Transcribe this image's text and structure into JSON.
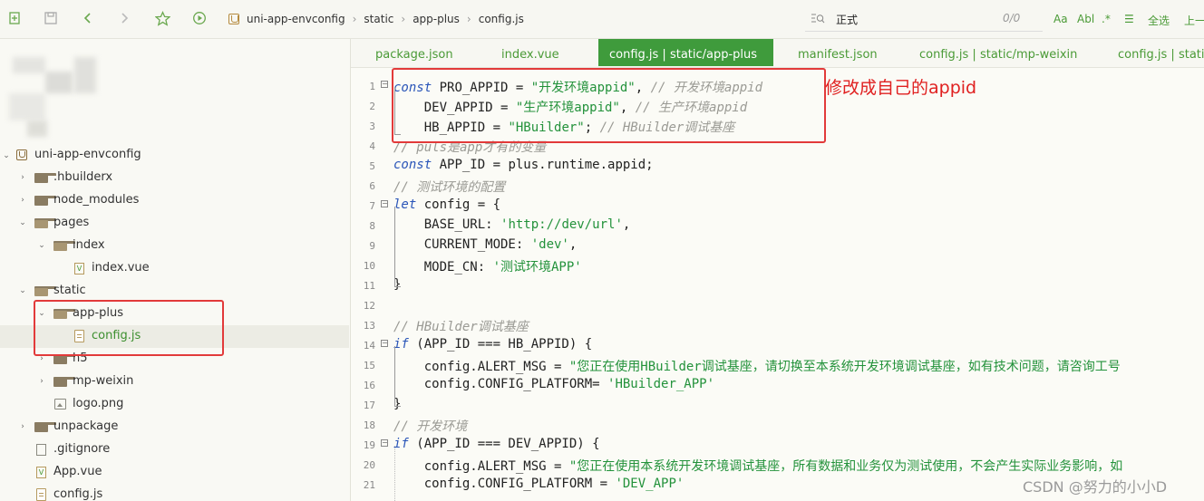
{
  "toolbar": {
    "icons": [
      "new-file-icon",
      "save-icon",
      "back-icon",
      "forward-icon",
      "star-icon",
      "run-icon"
    ],
    "breadcrumb": [
      "uni-app-envconfig",
      "static",
      "app-plus",
      "config.js"
    ],
    "search": {
      "value": "正式",
      "count": "0/0"
    },
    "options": {
      "case": "Aa",
      "word": "Abl",
      "regex": ".*",
      "multiline": "☰",
      "select_all": "全选",
      "prev": "上一"
    }
  },
  "sidebar": {
    "items": [
      {
        "label": "uni-app-envconfig"
      },
      {
        "label": ".hbuilderx"
      },
      {
        "label": "node_modules"
      },
      {
        "label": "pages"
      },
      {
        "label": "index"
      },
      {
        "label": "index.vue"
      },
      {
        "label": "static"
      },
      {
        "label": "app-plus"
      },
      {
        "label": "config.js"
      },
      {
        "label": "h5"
      },
      {
        "label": "mp-weixin"
      },
      {
        "label": "logo.png"
      },
      {
        "label": "unpackage"
      },
      {
        "label": ".gitignore"
      },
      {
        "label": "App.vue"
      },
      {
        "label": "config.js"
      }
    ]
  },
  "tabs": [
    {
      "label": "package.json"
    },
    {
      "label": "index.vue"
    },
    {
      "label": "config.js | static/app-plus"
    },
    {
      "label": "manifest.json"
    },
    {
      "label": "config.js | static/mp-weixin"
    },
    {
      "label": "config.js | static"
    }
  ],
  "editor": {
    "line_numbers": [
      "1",
      "2",
      "3",
      "4",
      "5",
      "6",
      "7",
      "8",
      "9",
      "10",
      "11",
      "12",
      "13",
      "14",
      "15",
      "16",
      "17",
      "18",
      "19",
      "20",
      "21"
    ]
  },
  "code_text": {
    "l1_kw": "const",
    "l1_a": " PRO_APPID = ",
    "l1_s": "\"开发环境appid\"",
    "l1_b": ", ",
    "l1_c": "// 开发环境appid",
    "l2_a": "    DEV_APPID = ",
    "l2_s": "\"生产环境appid\"",
    "l2_b": ", ",
    "l2_c": "// 生产环境appid",
    "l3_a": "    HB_APPID = ",
    "l3_s": "\"HBuilder\"",
    "l3_b": "; ",
    "l3_c": "// HBuilder调试基座",
    "l4_c": "// puls是app才有的变量",
    "l5_kw": "const",
    "l5_a": " APP_ID = plus.runtime.appid;",
    "l6_c": "// 测试环境的配置",
    "l7_kw": "let",
    "l7_a": " config = {",
    "l8_a": "    BASE_URL: ",
    "l8_s": "'http://dev/url'",
    "l8_b": ",",
    "l9_a": "    CURRENT_MODE: ",
    "l9_s": "'dev'",
    "l9_b": ",",
    "l10_a": "    MODE_CN: ",
    "l10_s": "'测试环境APP'",
    "l11_a": "}",
    "l13_c": "// HBuilder调试基座",
    "l14_kw": "if",
    "l14_a": " (APP_ID === HB_APPID) {",
    "l15_a": "    config.ALERT_MSG = ",
    "l15_s": "\"您正在使用HBuilder调试基座，请切换至本系统开发环境调试基座，如有技术问题，请咨询工号",
    "l16_a": "    config.CONFIG_PLATFORM= ",
    "l16_s": "'HBuilder_APP'",
    "l17_a": "}",
    "l18_c": "// 开发环境",
    "l19_kw": "if",
    "l19_a": " (APP_ID === DEV_APPID) {",
    "l20_a": "    config.ALERT_MSG = ",
    "l20_s": "\"您正在使用本系统开发环境调试基座，所有数据和业务仅为测试使用，不会产生实际业务影响，如",
    "l21_a": "    config.CONFIG_PLATFORM = ",
    "l21_s": "'DEV_APP'"
  },
  "annotation": "修改成自己的appid",
  "watermark": "CSDN @努力的小小D",
  "colors": {
    "accent": "#3f9b3c",
    "annotation": "#e02020",
    "keyword": "#2a55b8",
    "string": "#23923b",
    "comment": "#9a9a94"
  }
}
